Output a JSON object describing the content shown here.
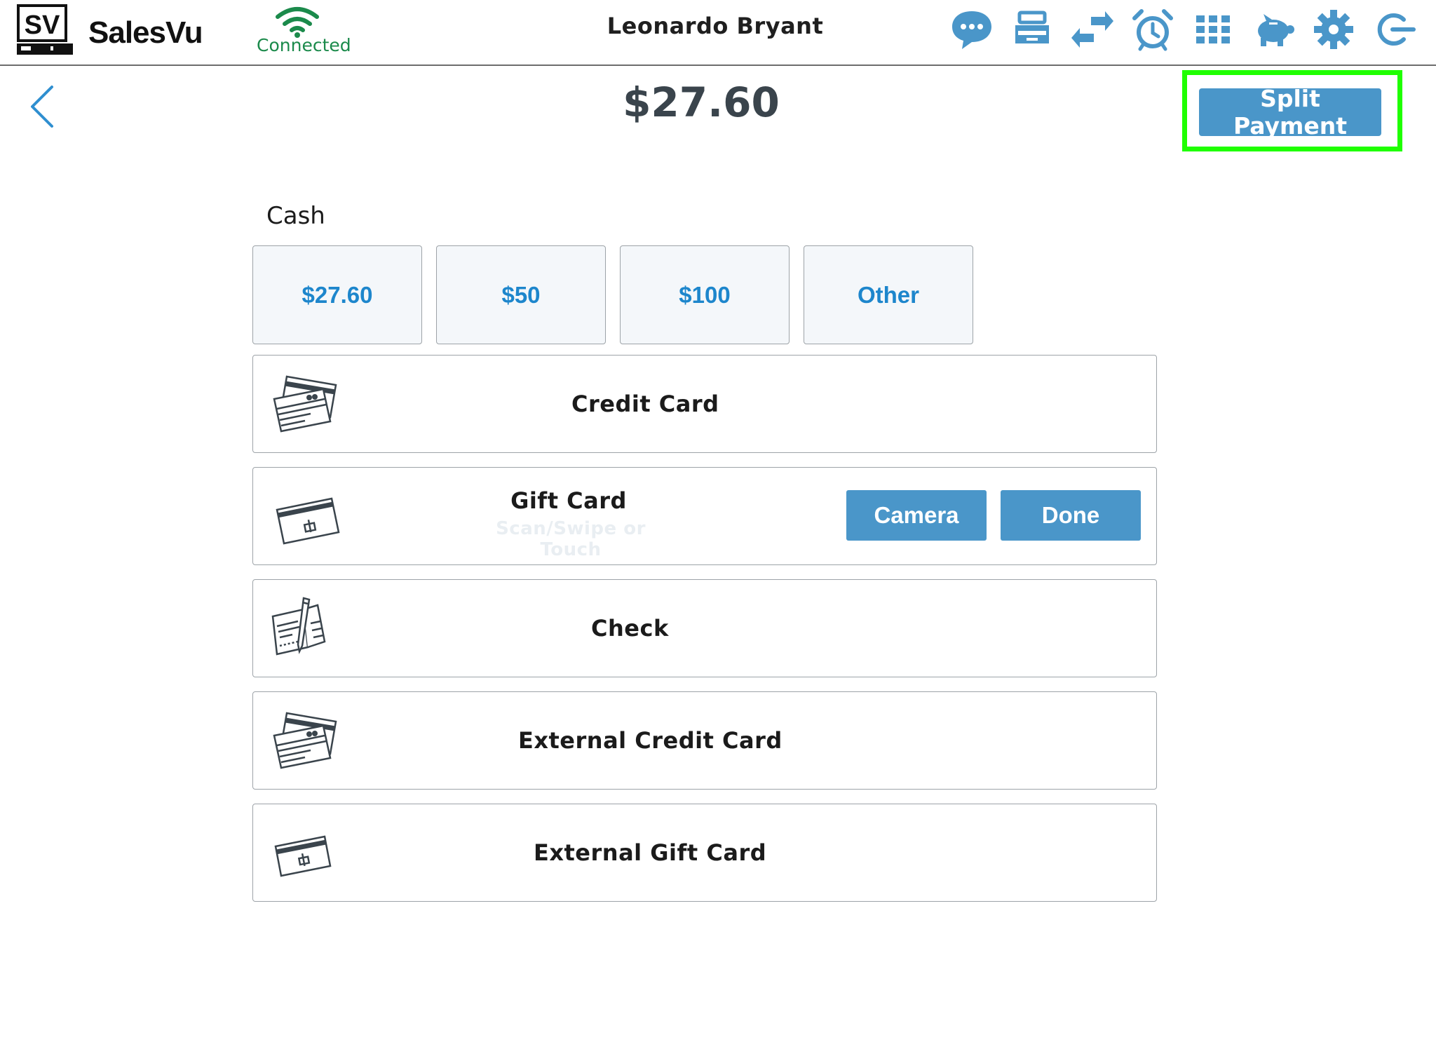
{
  "app": {
    "brand": "SalesVu",
    "logo_text": "SV",
    "status": "Connected",
    "user": "Leonardo Bryant",
    "accent": "#4a96c9",
    "status_color": "#1b8a4b",
    "highlight_color": "#1fff00"
  },
  "toolbar": {
    "icons": [
      "chat-icon",
      "cash-drawer-icon",
      "transfer-icon",
      "alarm-clock-icon",
      "grid-icon",
      "piggy-bank-icon",
      "gear-icon",
      "logout-icon"
    ]
  },
  "header": {
    "total": "$27.60",
    "split_label": "Split Payment"
  },
  "cash": {
    "label": "Cash",
    "options": [
      "$27.60",
      "$50",
      "$100",
      "Other"
    ]
  },
  "methods": {
    "credit_card": "Credit Card",
    "gift_card": "Gift Card",
    "gift_card_hint": "Scan/Swipe or Touch",
    "camera": "Camera",
    "done": "Done",
    "check": "Check",
    "external_credit_card": "External Credit Card",
    "external_gift_card": "External Gift Card"
  }
}
